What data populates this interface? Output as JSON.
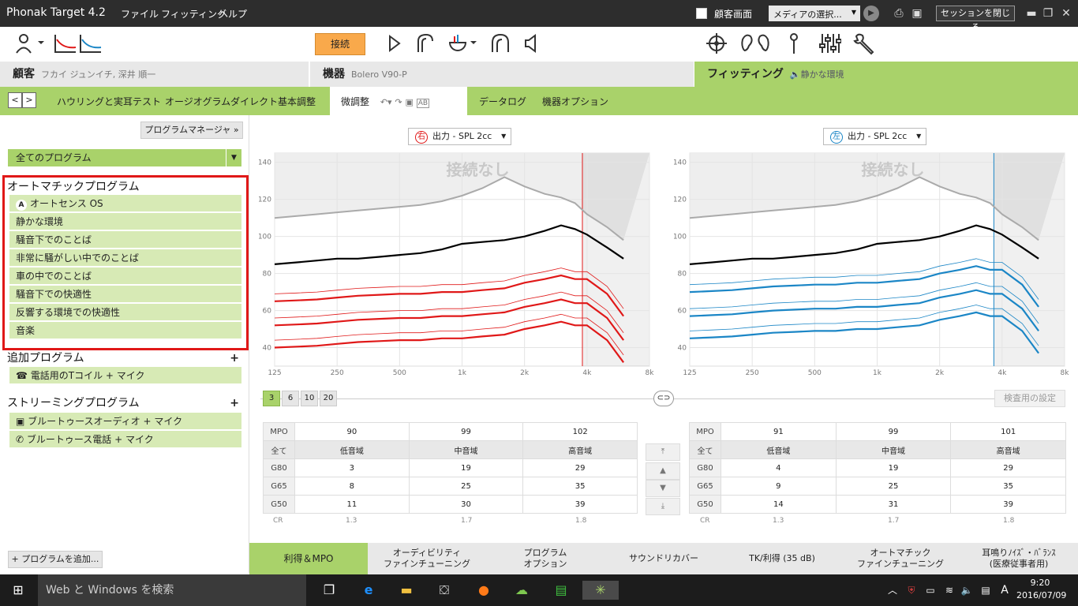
{
  "titlebar": {
    "app_title": "Phonak Target 4.2",
    "menu": [
      "ファイル",
      "フィッティング",
      "ヘルプ"
    ],
    "client_screen_label": "顧客画面",
    "media_select": "メディアの選択...",
    "close_session": "セッションを閉じる"
  },
  "toolbar": {
    "connect_label": "接続"
  },
  "headers": {
    "client_label": "顧客",
    "client_name": "フカイ ジュンイチ, 深井 順一",
    "device_label": "機器",
    "device_name": "Bolero V90-P",
    "fitting_label": "フィッティング",
    "fitting_env": "静かな環境"
  },
  "tabs": [
    "ハウリングと実耳テスト",
    "オージオグラムダイレクト",
    "基本調整",
    "微調整",
    "データログ",
    "機器オプション"
  ],
  "left_panel": {
    "program_manager": "プログラムマネージャ",
    "all_programs": "全てのプログラム",
    "auto_title": "オートマチックプログラム",
    "auto_programs": [
      "オートセンス OS",
      "静かな環境",
      "騒音下でのことば",
      "非常に騒がしい中でのことば",
      "車の中でのことば",
      "騒音下での快適性",
      "反響する環境での快適性",
      "音楽"
    ],
    "additional_title": "追加プログラム",
    "additional_programs": [
      "電話用のTコイル + マイク"
    ],
    "streaming_title": "ストリーミングプログラム",
    "streaming_programs": [
      "ブルートゥースオーディオ + マイク",
      "ブルートゥース電話 + マイク"
    ],
    "add_program": "プログラムを追加..."
  },
  "curves": {
    "right_selector": "出力 - SPL 2cc",
    "left_selector": "出力 - SPL 2cc",
    "right_badge": "右",
    "left_badge": "左",
    "no_connection": "接続なし",
    "y_ticks": [
      "140",
      "120",
      "100",
      "80",
      "60",
      "40"
    ],
    "x_ticks": [
      "125",
      "250",
      "500",
      "1k",
      "2k",
      "4k",
      "8k"
    ],
    "colors": {
      "right": "#e01818",
      "left": "#1b86c6",
      "mpo": "#000000",
      "ucl": "#aaaaaa"
    }
  },
  "level_buttons": [
    "3",
    "6",
    "10",
    "20"
  ],
  "test_settings": "検査用の設定",
  "gain_right": {
    "mpo_label": "MPO",
    "mpo": [
      "90",
      "99",
      "102"
    ],
    "all_label": "全て",
    "bands": [
      "低音域",
      "中音域",
      "高音域"
    ],
    "rows": [
      {
        "label": "G80",
        "values": [
          "3",
          "19",
          "29"
        ]
      },
      {
        "label": "G65",
        "values": [
          "8",
          "25",
          "35"
        ]
      },
      {
        "label": "G50",
        "values": [
          "11",
          "30",
          "39"
        ]
      }
    ],
    "cr_label": "CR",
    "cr": [
      "1.3",
      "1.7",
      "1.8"
    ]
  },
  "gain_left": {
    "mpo_label": "MPO",
    "mpo": [
      "91",
      "99",
      "101"
    ],
    "all_label": "全て",
    "bands": [
      "低音域",
      "中音域",
      "高音域"
    ],
    "rows": [
      {
        "label": "G80",
        "values": [
          "4",
          "19",
          "29"
        ]
      },
      {
        "label": "G65",
        "values": [
          "9",
          "25",
          "35"
        ]
      },
      {
        "label": "G50",
        "values": [
          "14",
          "31",
          "39"
        ]
      }
    ],
    "cr_label": "CR",
    "cr": [
      "1.3",
      "1.7",
      "1.8"
    ]
  },
  "bottom_tabs": [
    "利得＆MPO",
    "オーディビリティ\nファインチューニング",
    "プログラム\nオプション",
    "サウンドリカバー",
    "TK/利得 (35 dB)",
    "オートマチック\nファインチューニング",
    "耳鳴りﾉｲｽﾞ・ﾊﾞﾗﾝｽ\n(医療従事者用)"
  ],
  "taskbar": {
    "search": "Web と Windows を検索",
    "time": "9:20",
    "date": "2016/07/09",
    "ime": "A"
  }
}
